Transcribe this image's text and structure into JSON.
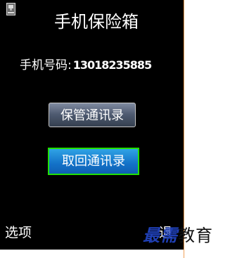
{
  "app": {
    "title": "手机保险箱"
  },
  "phone": {
    "label": "手机号码:",
    "value": "13018235885"
  },
  "buttons": {
    "archive": "保管通讯录",
    "retrieve": "取回通讯录"
  },
  "softkeys": {
    "left": "选项",
    "right": "退"
  },
  "watermark": {
    "blue_part": "最需",
    "dark_part": "教育"
  },
  "colors": {
    "screen_bg": "#000000",
    "focus_border": "#22e000",
    "focused_button": "#1372c8",
    "watermark_blue": "#1f3fb4"
  }
}
